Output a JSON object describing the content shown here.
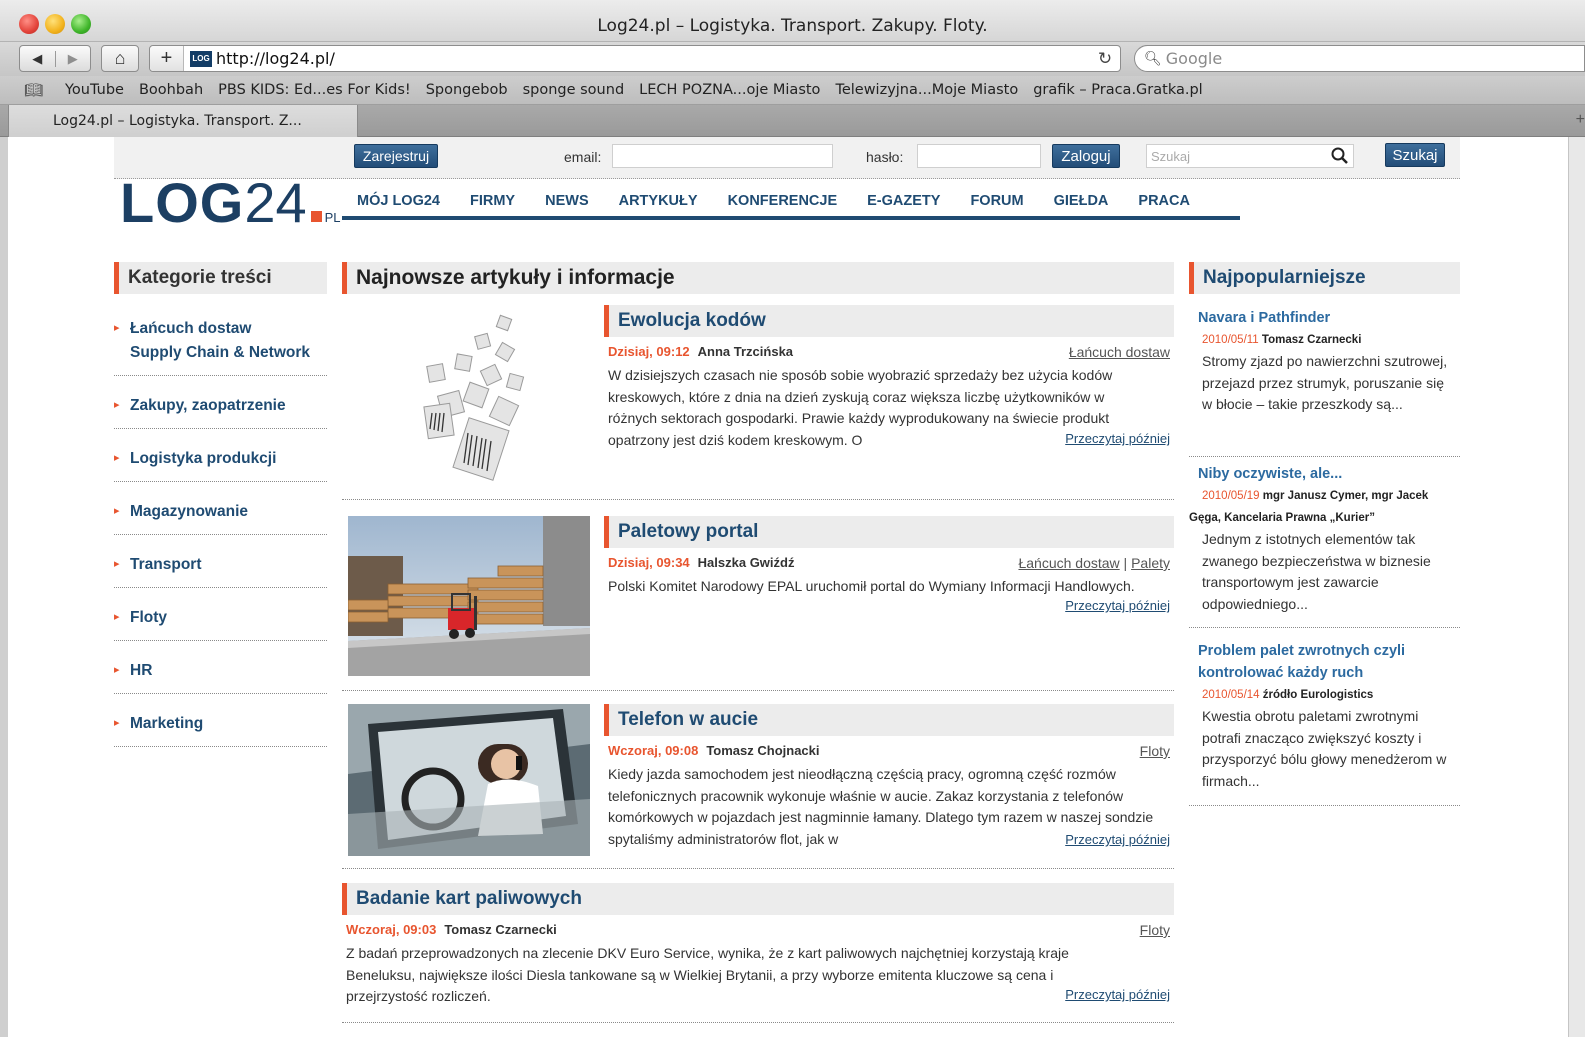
{
  "browser": {
    "window_title": "Log24.pl – Logistyka. Transport. Zakupy. Floty.",
    "url": "http://log24.pl/",
    "favicon_text": "LOG",
    "search_placeholder": "Google",
    "bookmarks": [
      "YouTube",
      "Boohbah",
      "PBS KIDS: Ed...es For Kids!",
      "Spongebob",
      "sponge sound",
      "LECH POZNA...oje Miasto",
      "Telewizyjna...Moje Miasto",
      "grafik – Praca.Gratka.pl"
    ],
    "tab_title": "Log24.pl – Logistyka. Transport. Z..."
  },
  "topbar": {
    "register_label": "Zarejestruj",
    "email_label": "email:",
    "password_label": "hasło:",
    "login_label": "Zaloguj",
    "search_placeholder": "Szukaj",
    "search_label": "Szukaj"
  },
  "logo": {
    "log": "LOG",
    "num": "24",
    "pl": "PL"
  },
  "nav": [
    "MÓJ LOG24",
    "FIRMY",
    "NEWS",
    "ARTYKUŁY",
    "KONFERENCJE",
    "E-GAZETY",
    "FORUM",
    "GIEŁDA",
    "PRACA"
  ],
  "categories": {
    "title": "Kategorie treści",
    "items": [
      {
        "label": "Łańcuch dostaw",
        "sub": "Supply Chain & Network"
      },
      {
        "label": "Zakupy, zaopatrzenie"
      },
      {
        "label": "Logistyka produkcji"
      },
      {
        "label": "Magazynowanie"
      },
      {
        "label": "Transport"
      },
      {
        "label": "Floty"
      },
      {
        "label": "HR"
      },
      {
        "label": "Marketing"
      }
    ]
  },
  "latest": {
    "title": "Najnowsze artykuły i informacje",
    "read_later": "Przeczytaj później",
    "articles": [
      {
        "title": "Ewolucja kodów",
        "date": "Dzisiaj, 09:12",
        "author": "Anna Trzcińska",
        "tag": "Łańcuch dostaw",
        "text": "W dzisiejszych czasach nie sposób sobie wyobrazić sprzedaży bez użycia kodów kreskowych, które z dnia na dzień zyskują coraz większa liczbę użytkowników w różnych sektorach gospodarki. Prawie każdy wyprodukowany na świecie produkt opatrzony jest dziś kodem kreskowym.  O"
      },
      {
        "title": "Paletowy portal",
        "date": "Dzisiaj, 09:34",
        "author": "Halszka Gwiźdź",
        "tag": "Łańcuch dostaw",
        "tag2": "Palety",
        "text": "Polski Komitet Narodowy EPAL uruchomił portal do Wymiany Informacji Handlowych."
      },
      {
        "title": "Telefon w aucie",
        "date": "Wczoraj, 09:08",
        "author": "Tomasz Chojnacki",
        "tag": "Floty",
        "text": "Kiedy jazda samochodem jest nieodłączną częścią pracy, ogromną część rozmów telefonicznych pracownik wykonuje właśnie w aucie. Zakaz korzystania z telefonów komórkowych w pojazdach jest nagminnie łamany. Dlatego tym razem w naszej sondzie spytaliśmy administratorów flot, jak w"
      },
      {
        "title": "Badanie kart paliwowych",
        "date": "Wczoraj, 09:03",
        "author": "Tomasz Czarnecki",
        "tag": "Floty",
        "text": "Z badań przeprowadzonych na zlecenie DKV Euro Service, wynika, że z kart paliwowych najchętniej korzystają kraje Beneluksu, największe ilości Diesla tankowane są w Wielkiej Brytanii, a przy wyborze emitenta kluczowe są cena i przejrzystość rozliczeń."
      }
    ]
  },
  "popular": {
    "title": "Najpopularniejsze",
    "items": [
      {
        "title": "Navara i Pathfinder",
        "date": "2010/05/11",
        "author": "Tomasz Czarnecki",
        "text": "Stromy zjazd po nawierzchni szutrowej, przejazd przez strumyk, poruszanie się w błocie – takie przeszkody są..."
      },
      {
        "title": "Niby oczywiste, ale...",
        "date": "2010/05/19",
        "author": "mgr Janusz Cymer, mgr Jacek Gęga, Kancelaria Prawna „Kurier”",
        "text": "Jednym z istotnych elementów tak zwanego bezpieczeństwa w biznesie transportowym jest zawarcie odpowiedniego..."
      },
      {
        "title": "Problem palet zwrotnych czyli kontrolować każdy ruch",
        "date": "2010/05/14",
        "author": "źródło Eurologistics",
        "text": "Kwestia obrotu paletami zwrotnymi potrafi znacząco zwiększyć koszty i przysporzyć bólu głowy menedżerom w firmach..."
      }
    ]
  },
  "colors": {
    "accent": "#e8552f",
    "brand": "#1f4b72",
    "link": "#2c6aa0"
  }
}
